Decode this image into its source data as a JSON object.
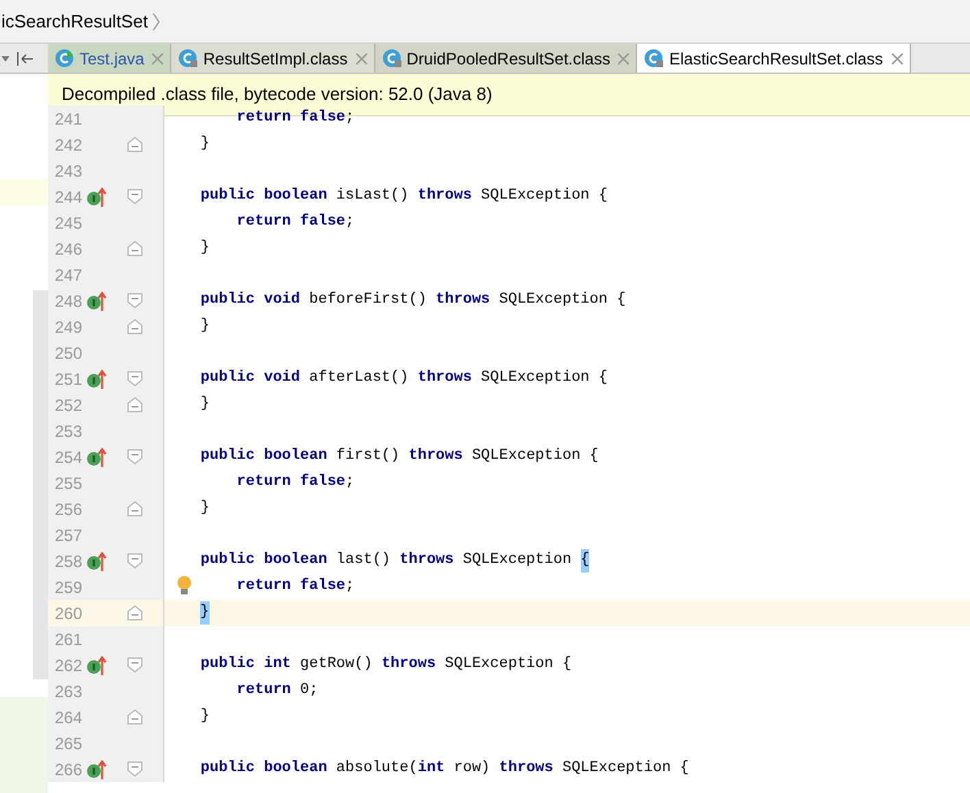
{
  "breadcrumb": {
    "label": "icSearchResultSet"
  },
  "tabs": [
    {
      "label": "Test.java",
      "kind": "java",
      "selected": false
    },
    {
      "label": "ResultSetImpl.class",
      "kind": "class",
      "selected": false
    },
    {
      "label": "DruidPooledResultSet.class",
      "kind": "class",
      "selected": false
    },
    {
      "label": "ElasticSearchResultSet.class",
      "kind": "class",
      "selected": true
    }
  ],
  "banner": "Decompiled .class file, bytecode version: 52.0 (Java 8)",
  "lines": [
    {
      "number": "241",
      "code": "        **return** **false**;",
      "kind": "plain",
      "override": false,
      "current": false,
      "bulb": false
    },
    {
      "number": "242",
      "code": "    }",
      "kind": "foldend",
      "override": false,
      "current": false,
      "bulb": false
    },
    {
      "number": "243",
      "kind": "plain",
      "override": false,
      "current": false,
      "bulb": false
    },
    {
      "number": "244",
      "code": "    **public** **boolean** isLast() **throws** SQLException {",
      "kind": "foldstart",
      "override": true,
      "current": false,
      "bulb": false
    },
    {
      "number": "245",
      "code": "        **return** **false**;",
      "kind": "plain",
      "override": false,
      "current": false,
      "bulb": false
    },
    {
      "number": "246",
      "code": "    }",
      "kind": "foldend",
      "override": false,
      "current": false,
      "bulb": false
    },
    {
      "number": "247",
      "kind": "plain",
      "override": false,
      "current": false,
      "bulb": false
    },
    {
      "number": "248",
      "code": "    **public** **void** beforeFirst() **throws** SQLException {",
      "kind": "foldstart",
      "override": true,
      "current": false,
      "bulb": false
    },
    {
      "number": "249",
      "code": "    }",
      "kind": "foldend",
      "override": false,
      "current": false,
      "bulb": false
    },
    {
      "number": "250",
      "kind": "plain",
      "override": false,
      "current": false,
      "bulb": false
    },
    {
      "number": "251",
      "code": "    **public** **void** afterLast() **throws** SQLException {",
      "kind": "foldstart",
      "override": true,
      "current": false,
      "bulb": false
    },
    {
      "number": "252",
      "code": "    }",
      "kind": "foldend",
      "override": false,
      "current": false,
      "bulb": false
    },
    {
      "number": "253",
      "kind": "plain",
      "override": false,
      "current": false,
      "bulb": false
    },
    {
      "number": "254",
      "code": "    **public** **boolean** first() **throws** SQLException {",
      "kind": "foldstart",
      "override": true,
      "current": false,
      "bulb": false
    },
    {
      "number": "255",
      "code": "        **return** **false**;",
      "kind": "plain",
      "override": false,
      "current": false,
      "bulb": false
    },
    {
      "number": "256",
      "code": "    }",
      "kind": "foldend",
      "override": false,
      "current": false,
      "bulb": false
    },
    {
      "number": "257",
      "kind": "plain",
      "override": false,
      "current": false,
      "bulb": false
    },
    {
      "number": "258",
      "code": "    **public** **boolean** last() **throws** SQLException ",
      "match": "{",
      "kind": "foldstart",
      "override": true,
      "current": false,
      "bulb": false
    },
    {
      "number": "259",
      "code": "        **return** **false**;",
      "kind": "plain",
      "override": false,
      "current": false,
      "bulb": true
    },
    {
      "number": "260",
      "match": "}",
      "kind": "foldend",
      "override": false,
      "current": true,
      "bulb": false
    },
    {
      "number": "261",
      "kind": "plain",
      "override": false,
      "current": false,
      "bulb": false
    },
    {
      "number": "262",
      "code": "    **public** **int** getRow() **throws** SQLException {",
      "kind": "foldstart",
      "override": true,
      "current": false,
      "bulb": false
    },
    {
      "number": "263",
      "code": "        **return** 0;",
      "kind": "plain",
      "override": false,
      "current": false,
      "bulb": false
    },
    {
      "number": "264",
      "code": "    }",
      "kind": "foldend",
      "override": false,
      "current": false,
      "bulb": false
    },
    {
      "number": "265",
      "kind": "plain",
      "override": false,
      "current": false,
      "bulb": false
    },
    {
      "number": "266",
      "code": "    **public** **boolean** absolute(**int** row) **throws** SQLException {",
      "kind": "foldstart",
      "override": true,
      "current": false,
      "bulb": false
    }
  ]
}
